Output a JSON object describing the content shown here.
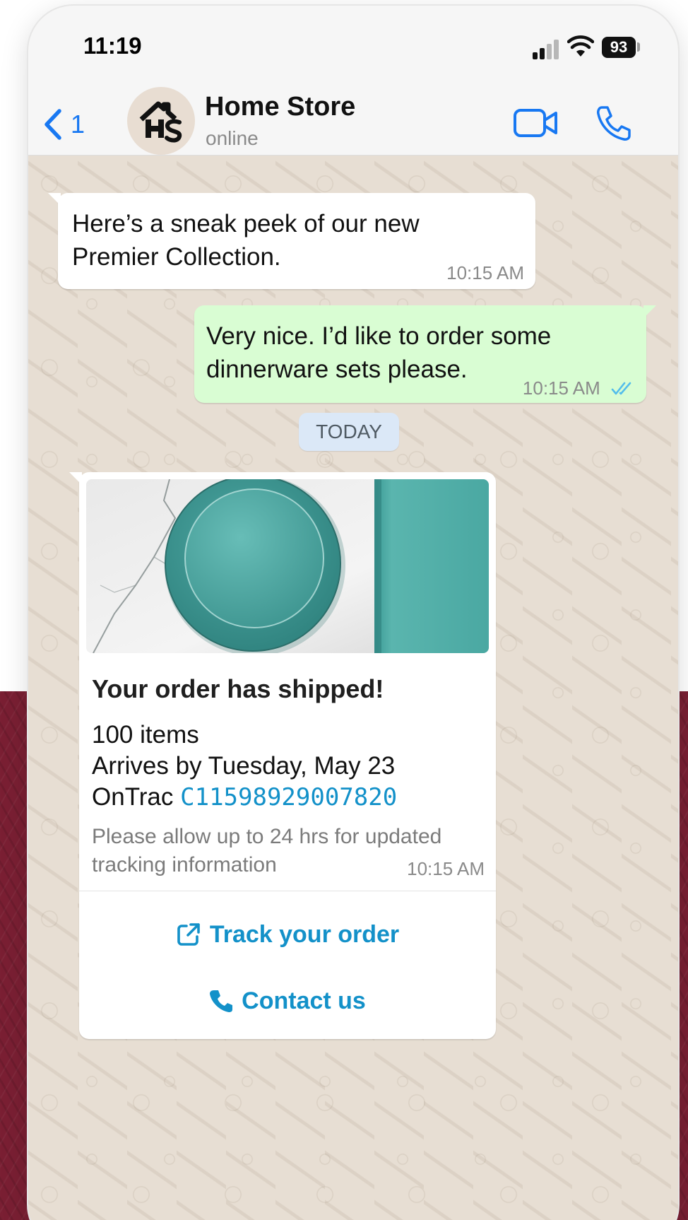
{
  "status_bar": {
    "time": "11:19",
    "battery": "93",
    "icons": [
      "cellular-signal-icon",
      "wifi-icon",
      "battery-icon"
    ]
  },
  "header": {
    "back_count": "1",
    "avatar_text": "Hs",
    "contact_name": "Home Store",
    "contact_status": "online",
    "icons": [
      "back-chevron-icon",
      "video-call-icon",
      "phone-call-icon"
    ],
    "accent_color": "#1878f2"
  },
  "messages": [
    {
      "direction": "incoming",
      "text_lines": [
        "Here’s a sneak peek of our new",
        "Premier Collection."
      ],
      "time": "10:15 AM"
    },
    {
      "direction": "outgoing",
      "text_lines": [
        "Very nice. I’d like to order some",
        "dinnerware sets please."
      ],
      "time": "10:15 AM",
      "status_icon": "double-check-icon"
    }
  ],
  "date_divider": "TODAY",
  "order_card": {
    "title": "Your order has shipped!",
    "items": "100 items",
    "arrival": "Arrives by Tuesday, May 23",
    "carrier": "OnTrac",
    "tracking_number": "C11598929007820",
    "note": "Please allow up to 24 hrs for updated tracking information",
    "time": "10:15 AM",
    "actions": [
      {
        "label": "Track your order",
        "icon": "external-link-icon"
      },
      {
        "label": "Contact us",
        "icon": "phone-icon"
      }
    ],
    "link_color": "#1391c9"
  },
  "colors": {
    "outgoing_bubble": "#d9fdd3",
    "incoming_bubble": "#ffffff",
    "chat_background": "#e7ded3",
    "date_chip": "#dbe8f7",
    "page_backdrop": "#7a1f33"
  }
}
